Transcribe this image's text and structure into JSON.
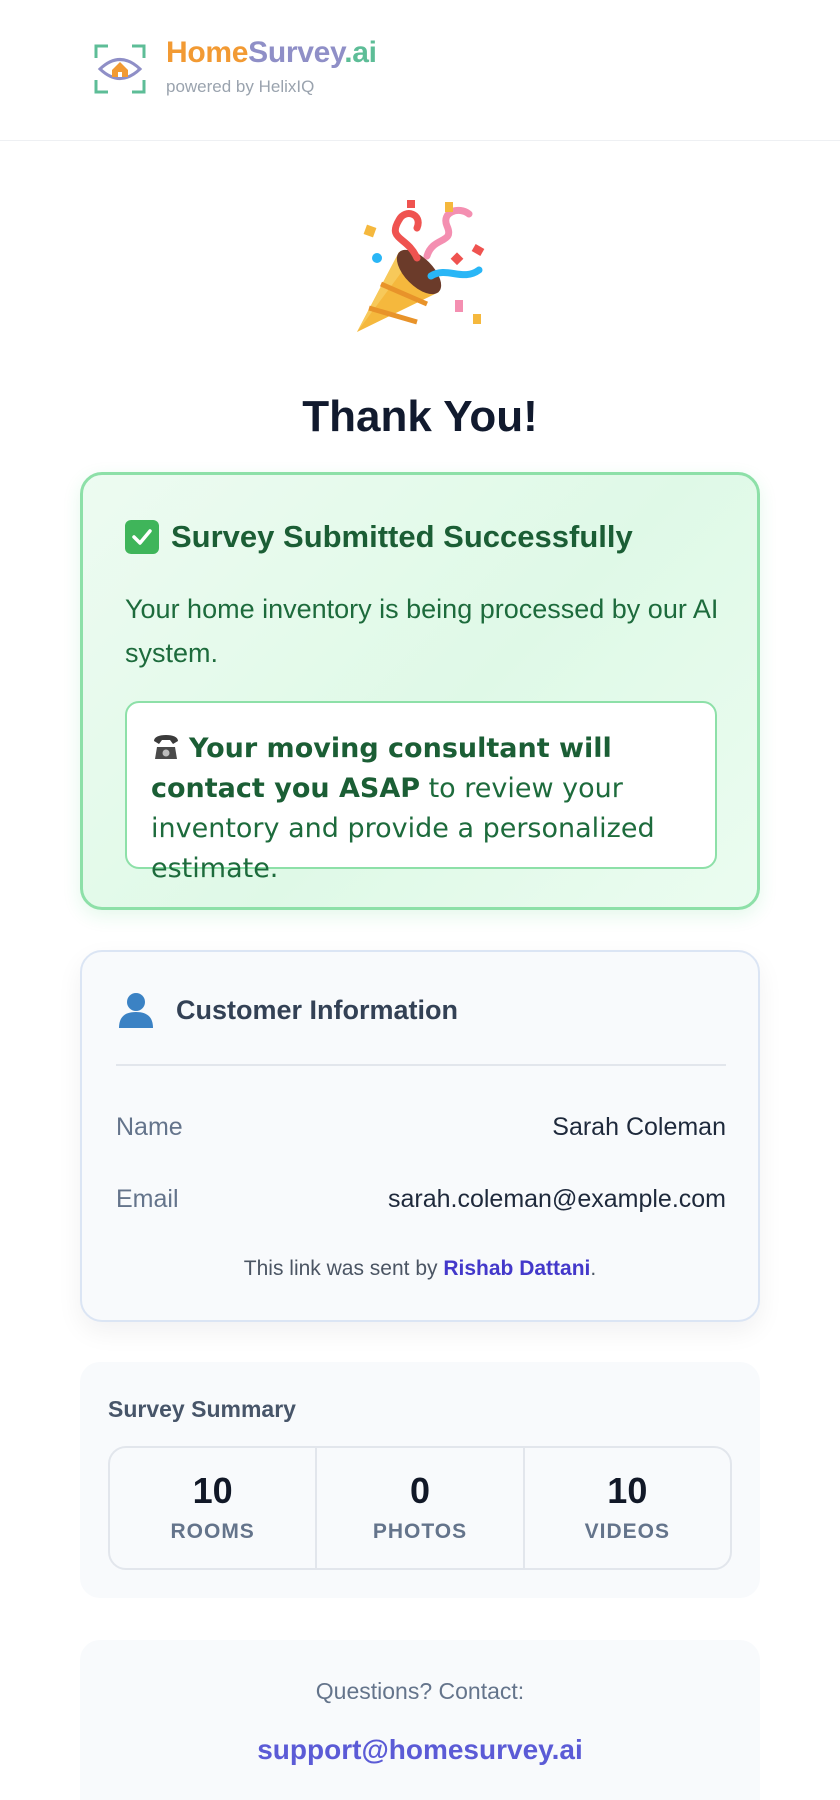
{
  "header": {
    "brand_home": "Home",
    "brand_survey": "Survey",
    "brand_ai": ".ai",
    "powered_by": "powered by HelixIQ"
  },
  "hero": {
    "emoji": "party-popper-icon"
  },
  "page_title": "Thank You!",
  "success": {
    "title": "Survey Submitted Successfully",
    "message": "Your home inventory is being processed by our AI system.",
    "contact_bold": "Your moving consultant will contact you ASAP",
    "contact_rest": " to review your inventory and provide a personalized estimate."
  },
  "customer": {
    "title": "Customer Information",
    "name_label": "Name",
    "name_value": "Sarah Coleman",
    "email_label": "Email",
    "email_value": "sarah.coleman@example.com",
    "sent_prefix": "This link was sent by ",
    "sender": "Rishab Dattani",
    "sent_suffix": "."
  },
  "summary": {
    "title": "Survey Summary",
    "stats": [
      {
        "value": "10",
        "label": "ROOMS"
      },
      {
        "value": "0",
        "label": "PHOTOS"
      },
      {
        "value": "10",
        "label": "VIDEOS"
      }
    ]
  },
  "footer": {
    "questions": "Questions? Contact:",
    "support_email": "support@homesurvey.ai"
  },
  "colors": {
    "success_border": "#8de0a8",
    "success_text": "#1b5e35",
    "link": "#5b5bd6",
    "brand_orange": "#f29a33",
    "brand_purple": "#8f8fc7",
    "brand_green": "#5dbd97"
  }
}
